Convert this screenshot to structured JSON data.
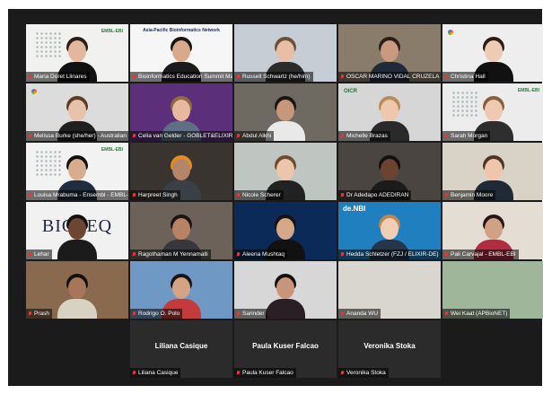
{
  "tiles": [
    {
      "name": "Maria Doret Llinares",
      "label": "Maria Doret Llinares",
      "kind": "video",
      "bg": "#f1f1ef",
      "skin": "#e3b79c",
      "hair": "#2b1d14",
      "shirt": "#111111",
      "decor": "embl"
    },
    {
      "name": "Bioinformatics Education Summit",
      "label": "Bioinformatics Education Summit Main ...",
      "kind": "video",
      "bg": "#f6f6f6",
      "skin": "#d9a98b",
      "hair": "#1a1412",
      "shirt": "#1b1b1b",
      "decor": "banner",
      "banner_text": "Asia-Pacific Bioinformatics Network",
      "highlight": true
    },
    {
      "name": "Russell Schwartz",
      "label": "Russell Schwartz (he/him)",
      "kind": "video",
      "bg": "#c7cdd4",
      "skin": "#e8bfa4",
      "hair": "#6b5038",
      "shirt": "#2b2b2b"
    },
    {
      "name": "Oscar Marino Vidal Cruzela",
      "label": "OSCAR MARINO VIDAL CRUZELA",
      "kind": "video",
      "bg": "#8a7c6a",
      "skin": "#c99a7e",
      "hair": "#2a1f18",
      "shirt": "#1f2a3a"
    },
    {
      "name": "Christina Hall",
      "label": "Christina Hall",
      "kind": "video",
      "bg": "#eeeeee",
      "skin": "#efcbb5",
      "hair": "#2a1c15",
      "shirt": "#111111",
      "decor": "bc"
    },
    {
      "name": "Melissa Burke",
      "label": "Melissa Burke (she/her) - Australian Bi...",
      "kind": "video",
      "bg": "#dcdcdc",
      "skin": "#e7c3ab",
      "hair": "#5e3b22",
      "shirt": "#202020",
      "decor": "bc"
    },
    {
      "name": "Celia van Gelder",
      "label": "Celia van Gelder - GOBLET&ELIXIR",
      "kind": "video",
      "bg": "#5b2f7a",
      "skin": "#e7b99f",
      "hair": "#8f6a45",
      "shirt": "#5e6f86"
    },
    {
      "name": "Abdul Alkhi",
      "label": "Abdul Alkhi",
      "kind": "video",
      "bg": "#6f6a61",
      "skin": "#c6977a",
      "hair": "#1c1511",
      "shirt": "#e9e9e9"
    },
    {
      "name": "Michelle Brazas",
      "label": "Michelle Brazas",
      "kind": "video",
      "bg": "#d6d6d6",
      "skin": "#efc7ab",
      "hair": "#b58d5a",
      "shirt": "#2a2a2a",
      "decor": "oicr"
    },
    {
      "name": "Sarah Morgan",
      "label": "Sarah Morgan",
      "kind": "video",
      "bg": "#ececec",
      "skin": "#f0c9b2",
      "hair": "#8a5f3f",
      "shirt": "#2e2e2e",
      "decor": "embl"
    },
    {
      "name": "Louisa Mrabuma",
      "label": "Louisa Mrabuma - Ensembl - EMBL-...",
      "kind": "video",
      "bg": "#f2f2f2",
      "skin": "#d8ac8f",
      "hair": "#151010",
      "shirt": "#1f2d3e",
      "decor": "embl"
    },
    {
      "name": "Harpreet Singh",
      "label": "Harpreet Singh",
      "kind": "video",
      "bg": "#3a3430",
      "skin": "#b3866a",
      "hair": "#e38b1e",
      "shirt": "#3b4046"
    },
    {
      "name": "Nicole Scherer",
      "label": "Nicole Scherer",
      "kind": "video",
      "bg": "#bfc6c1",
      "skin": "#ecc5ab",
      "hair": "#6e4c2f",
      "shirt": "#222222"
    },
    {
      "name": "Dr Adedapo Adediran",
      "label": "Dr Adedapo ADEDIRAN",
      "kind": "video",
      "bg": "#4a4540",
      "skin": "#6b4431",
      "hair": "#111111",
      "shirt": "#1b1b1b"
    },
    {
      "name": "Benjamin Moore",
      "label": "Benjamin Moore",
      "kind": "video",
      "bg": "#d9d2c6",
      "skin": "#efc6ab",
      "hair": "#4f3522",
      "shirt": "#1f2a36"
    },
    {
      "name": "Lehar",
      "label": "Lehar",
      "kind": "video",
      "bg": "#f1f1f1",
      "skin": "#6d4633",
      "hair": "#151010",
      "shirt": "#1b1b1b",
      "decor": "bigtext",
      "bigtext": "BIOSEQ"
    },
    {
      "name": "Ragothaman M Yennamalli",
      "label": "Ragothaman M Yennamalli",
      "kind": "video",
      "bg": "#6c625a",
      "skin": "#b78266",
      "hair": "#1b1410",
      "shirt": "#36383b"
    },
    {
      "name": "Aleena Mushtaq",
      "label": "Aleena Mushtaq",
      "kind": "video",
      "bg": "#0c2a57",
      "skin": "#d6a88a",
      "hair": "#1a1212",
      "shirt": "#111111"
    },
    {
      "name": "Hedda Schletzer",
      "label": "Hedda Schletzer (FZJ / ELIXIR-DE)",
      "kind": "video",
      "bg": "#1f7fbf",
      "skin": "#f1cdb4",
      "hair": "#b98854",
      "shirt": "#25364c",
      "decor": "denbi",
      "denbi_text": "de.NBI"
    },
    {
      "name": "Pali Carvajal",
      "label": "Pali Carvajal - EMBL-EBI",
      "kind": "video",
      "bg": "#e4ddd4",
      "skin": "#d1a183",
      "hair": "#231714",
      "shirt": "#b02c3e"
    },
    {
      "name": "Prash",
      "label": "Prash",
      "kind": "video",
      "bg": "#8a6a4f",
      "skin": "#a67659",
      "hair": "#151010",
      "shirt": "#d8d2c3"
    },
    {
      "name": "Rodrigo O. Polo",
      "label": "Rodrigo O. Polo",
      "kind": "video",
      "bg": "#6f98c4",
      "skin": "#d4a384",
      "hair": "#1a1412",
      "shirt": "#c53a3a"
    },
    {
      "name": "Sarinder",
      "label": "Sarinder",
      "kind": "video",
      "bg": "#d7d7d7",
      "skin": "#c9957a",
      "hair": "#151010",
      "shirt": "#2a1f25"
    },
    {
      "name": "Ananda Wu",
      "label": "Ananda WU",
      "kind": "video",
      "bg": "#d8d6cf",
      "skin": "#000000",
      "hair": "#000000",
      "shirt": "#000000",
      "empty": true
    },
    {
      "name": "Wei Kaat",
      "label": "Wei Kaat (APBioNET)",
      "kind": "video",
      "bg": "#9fb69a",
      "skin": "#000000",
      "hair": "#000000",
      "shirt": "#000000",
      "empty": true
    },
    {
      "name": "Liliana Casique",
      "label": "Liliana Casique",
      "kind": "name",
      "display": "Liliana Casique"
    },
    {
      "name": "Paula Kuser Falcao",
      "label": "Paula Kuser Falcao",
      "kind": "name",
      "display": "Paula Kuser Falcao"
    },
    {
      "name": "Veronika Stoka",
      "label": "Veronika Stoka",
      "kind": "name",
      "display": "Veronika Stoka"
    }
  ],
  "colors": {
    "stage": "#1b1b1b",
    "active_speaker": "#e5d44d",
    "muted": "#e0393e"
  }
}
